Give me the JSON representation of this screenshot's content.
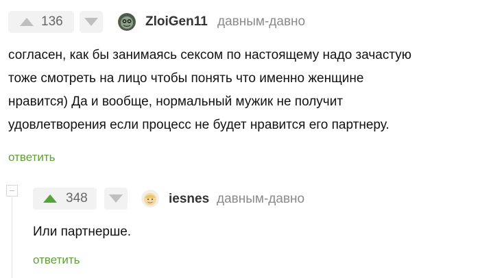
{
  "comments": [
    {
      "rating": "136",
      "username": "ZloiGen11",
      "time": "давным-давно",
      "lines": [
        "согласен, как бы занимаясь сексом по настоящему надо зачастую",
        "тоже смотреть на лицо чтобы понять что именно женщине",
        "нравится) Да и вообще, нормальный мужик не получит",
        "удовлетворения если процесс не будет нравится его партнеру."
      ],
      "reply_label": "ответить",
      "avatar": "cat-avatar-icon"
    },
    {
      "rating": "348",
      "username": "iesnes",
      "time": "давным-давно",
      "lines": [
        "Или партнерше."
      ],
      "reply_label": "ответить",
      "avatar": "face-avatar-icon",
      "upvoted": true
    }
  ],
  "colors": {
    "accent_green": "#5e9f36",
    "upvote_active": "#53a338",
    "arrow_inactive": "#bfbfbf"
  }
}
